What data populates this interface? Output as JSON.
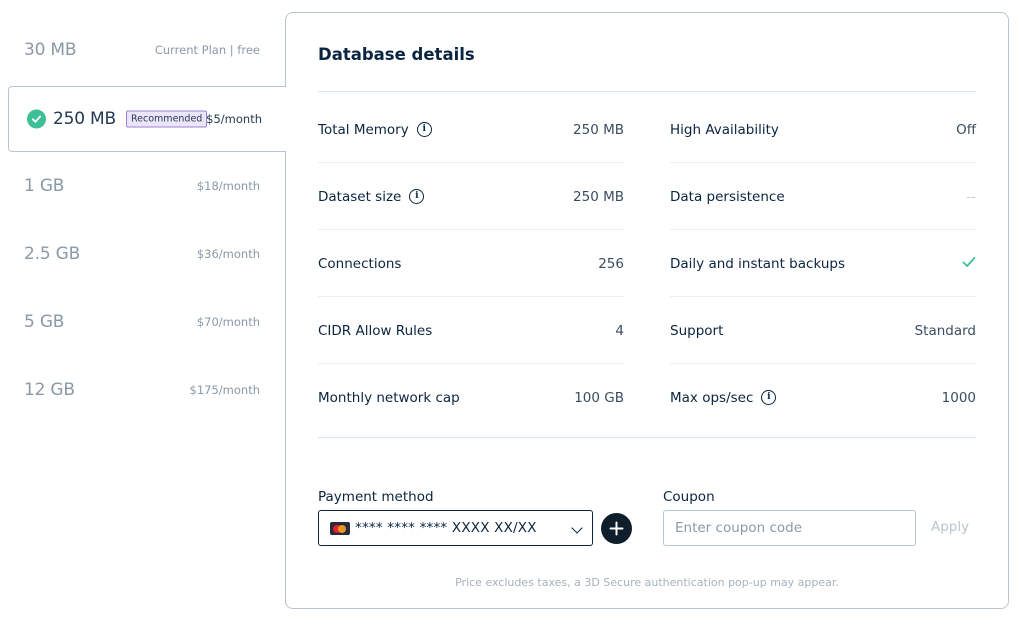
{
  "plans": [
    {
      "size": "30 MB",
      "price": "Current Plan | free"
    },
    {
      "size": "250 MB",
      "badge": "Recommended",
      "price": "$5/month"
    },
    {
      "size": "1 GB",
      "price": "$18/month"
    },
    {
      "size": "2.5 GB",
      "price": "$36/month"
    },
    {
      "size": "5 GB",
      "price": "$70/month"
    },
    {
      "size": "12 GB",
      "price": "$175/month"
    }
  ],
  "details": {
    "title": "Database details",
    "left": [
      {
        "label": "Total Memory",
        "value": "250 MB"
      },
      {
        "label": "Dataset size",
        "value": "250 MB"
      },
      {
        "label": "Connections",
        "value": "256"
      },
      {
        "label": "CIDR Allow Rules",
        "value": "4"
      },
      {
        "label": "Monthly network cap",
        "value": "100 GB"
      }
    ],
    "right": [
      {
        "label": "High Availability",
        "value": "Off"
      },
      {
        "label": "Data persistence",
        "value": "--"
      },
      {
        "label": "Daily and instant backups",
        "value": "✓"
      },
      {
        "label": "Support",
        "value": "Standard"
      },
      {
        "label": "Max ops/sec",
        "value": "1000"
      }
    ]
  },
  "payment": {
    "label": "Payment method",
    "selected": "**** **** **** XXXX XX/XX"
  },
  "coupon": {
    "label": "Coupon",
    "placeholder": "Enter coupon code",
    "apply": "Apply"
  },
  "note": "Price excludes taxes, a 3D Secure authentication pop-up may appear.",
  "colors": {
    "accent_check": "#3fbf96",
    "badge_bg": "#ece5fa",
    "badge_border": "#9a83d6",
    "text_dark": "#0b2540",
    "text_muted": "#8a99a8"
  }
}
